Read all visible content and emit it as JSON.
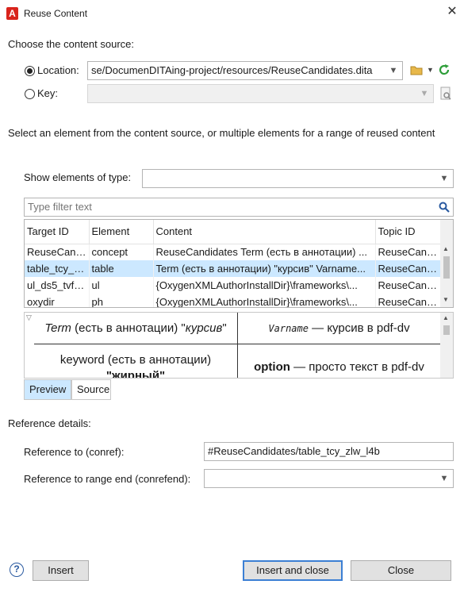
{
  "window": {
    "title": "Reuse Content",
    "app_icon_letter": "A"
  },
  "source": {
    "heading": "Choose the content source:",
    "location_label": "Location:",
    "location_value": "se/DocumenDITAing-project/resources/ReuseCandidates.dita",
    "key_label": "Key:",
    "key_value": ""
  },
  "select_instructions": "Select an element from the content source, or multiple elements for a range of reused content",
  "show_elements": {
    "label": "Show elements of type:",
    "value": ""
  },
  "filter": {
    "placeholder": "Type filter text"
  },
  "table": {
    "columns": [
      "Target ID",
      "Element",
      "Content",
      "Topic ID"
    ],
    "rows": [
      [
        "ReuseCandi...",
        "concept",
        "ReuseCandidates Term (есть в аннотации) ...",
        "ReuseCand..."
      ],
      [
        "table_tcy_zl...",
        "table",
        "Term (есть в аннотации) \"курсив\" Varname...",
        "ReuseCand..."
      ],
      [
        "ul_ds5_tvf_...",
        "ul",
        "{OxygenXMLAuthorInstallDir}\\frameworks\\...",
        "ReuseCand..."
      ],
      [
        "oxydir",
        "ph",
        "{OxygenXMLAuthorInstallDir}\\frameworks\\...",
        "ReuseCand..."
      ]
    ],
    "selected_index": 1
  },
  "preview": {
    "cell_1": {
      "term": "Term",
      "annot": " (есть в аннотации) \"",
      "italic": "курсив",
      "end": "\""
    },
    "cell_2": {
      "varname": "Varname",
      "rest": " — курсив в pdf-dv"
    },
    "cell_3": {
      "line1": "keyword (есть в аннотации)",
      "line2": "\"жирный\""
    },
    "cell_4": {
      "bold": "option",
      "rest": " — просто текст в pdf-dv"
    },
    "tabs": [
      "Preview",
      "Source"
    ]
  },
  "reference": {
    "heading": "Reference details:",
    "conref_label": "Reference to (conref):",
    "conref_value": "#ReuseCandidates/table_tcy_zlw_l4b",
    "conrefend_label": "Reference to range end  (conrefend):",
    "conrefend_value": ""
  },
  "buttons": {
    "insert": "Insert",
    "insert_close": "Insert and close",
    "close": "Close"
  },
  "colors": {
    "selection": "#cce8ff",
    "default_button_border": "#3c7fd4",
    "refresh_green": "#2e9e3a",
    "folder_yellow": "#e8b84a"
  }
}
